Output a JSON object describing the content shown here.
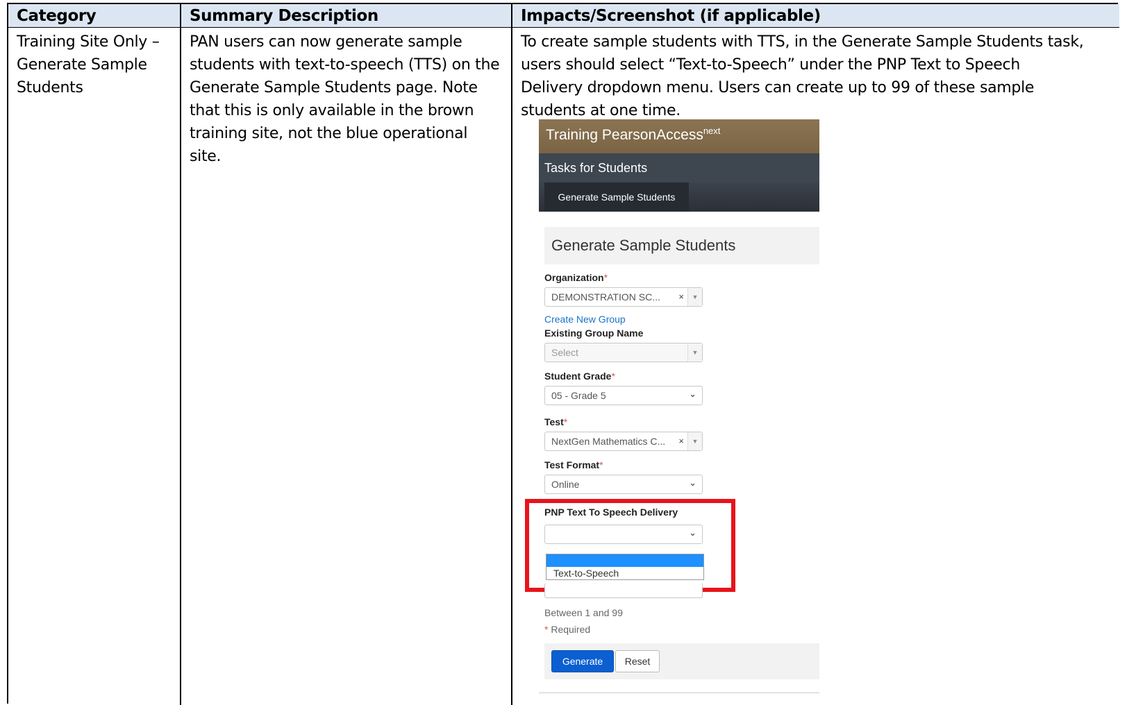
{
  "table": {
    "headers": [
      "Category",
      "Summary Description",
      "Impacts/Screenshot (if applicable)"
    ],
    "row": {
      "category_lines": [
        "Training Site Only –",
        "Generate Sample",
        "Students"
      ],
      "summary_lines": [
        "PAN users can now generate sample",
        "students with text-to-speech (TTS) on the",
        "Generate Sample Students page. Note",
        "that this is only available in the brown",
        "training site, not the blue operational",
        "site."
      ],
      "impacts_lines": [
        "To create sample students with TTS, in the Generate Sample Students task,",
        "users should select “Text-to-Speech” under the PNP Text to Speech",
        "Delivery dropdown menu. Users can create up to 99 of these sample",
        "students at one time."
      ]
    }
  },
  "screenshot": {
    "site_title": "Training PearsonAccess",
    "site_title_sup": "next",
    "tasks_title": "Tasks for Students",
    "subtab": "Generate Sample Students",
    "panel_title": "Generate Sample Students",
    "organization_label": "Organization",
    "organization_value": "DEMONSTRATION SC...",
    "create_group_link": "Create New Group",
    "existing_group_label": "Existing Group Name",
    "existing_group_value": "Select",
    "grade_label": "Student Grade",
    "grade_value": "05 - Grade 5",
    "test_label": "Test",
    "test_value": "NextGen Mathematics C...",
    "format_label": "Test Format",
    "format_value": "Online",
    "tts_label": "PNP Text To Speech Delivery",
    "tts_value": "",
    "tts_option": "Text-to-Speech",
    "range_hint": "Between 1 and 99",
    "required_star": "*",
    "required_text": " Required",
    "generate_button": "Generate",
    "reset_button": "Reset",
    "colors": {
      "brown": "#7a6444",
      "dark": "#3e4650",
      "highlight": "#e8141b",
      "primary": "#0b5fd1"
    }
  }
}
